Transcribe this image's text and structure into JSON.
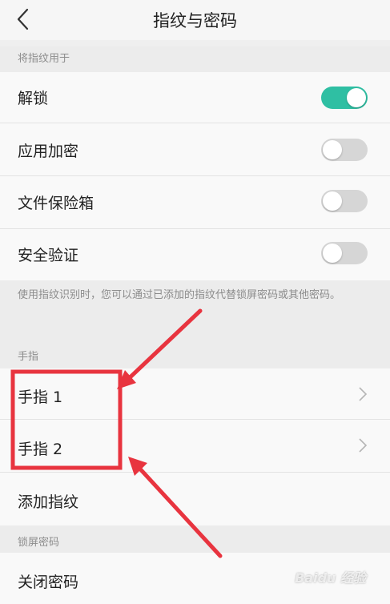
{
  "header": {
    "title": "指纹与密码"
  },
  "sections": {
    "fingerprint_use": {
      "title": "将指纹用于",
      "items": [
        {
          "label": "解锁",
          "enabled": true
        },
        {
          "label": "应用加密",
          "enabled": false
        },
        {
          "label": "文件保险箱",
          "enabled": false
        },
        {
          "label": "安全验证",
          "enabled": false
        }
      ],
      "description": "使用指纹识别时，您可以通过已添加的指纹代替锁屏密码或其他密码。"
    },
    "fingers": {
      "title": "手指",
      "items": [
        {
          "label": "手指 1"
        },
        {
          "label": "手指 2"
        }
      ],
      "add_label": "添加指纹"
    },
    "lock_password": {
      "title": "锁屏密码",
      "items": [
        {
          "label": "关闭密码"
        }
      ]
    }
  },
  "annotation": {
    "color": "#e8343f"
  },
  "colors": {
    "accent": "#2fbfa3"
  }
}
